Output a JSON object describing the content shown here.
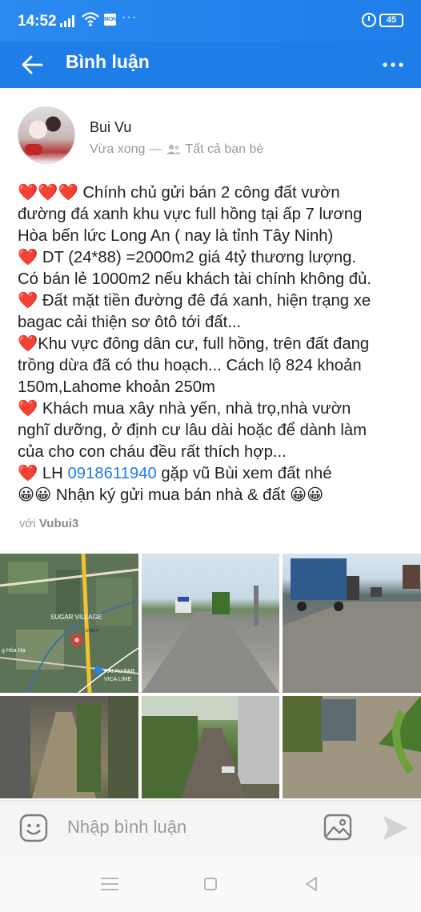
{
  "status_bar": {
    "time": "14:52",
    "battery": "45",
    "app_badge": "MON",
    "more_dots": "···"
  },
  "app_bar": {
    "title": "Bình luận",
    "back_icon": "arrow-left-icon",
    "more_icon": "more-horizontal-icon"
  },
  "post": {
    "author": "Bui Vu",
    "time": "Vừa xong",
    "separator": "—",
    "audience": "Tất cả bạn bè",
    "lines": [
      {
        "prefix": "❤️❤️❤️ ",
        "text": "Chính chủ gửi bán 2 công đất vườn\nđường đá xanh khu vực full hồng tại ấp 7 lương\nHòa bến lức Long An ( nay là tỉnh Tây Ninh)"
      },
      {
        "prefix": "❤️ ",
        "text": "DT (24*88) =2000m2 giá 4tỷ thương lượng.\nCó bán lẻ 1000m2 nếu khách tài chính không đủ."
      },
      {
        "prefix": "❤️ ",
        "text": "Đất mặt tiền đường đê đá xanh, hiện trạng xe\nbagac cải thiện sơ ôtô tới đất..."
      },
      {
        "prefix": "❤️",
        "text": "Khu vực đông dân cư, full hồng, trên đất đang\ntrồng dừa đã có thu hoạch... Cách lộ 824 khoản\n150m,Lahome khoản 250m"
      },
      {
        "prefix": "❤️ ",
        "text": "Khách mua xây nhà yến, nhà trọ,nhà vườn\nnghĩ dưỡng, ở định cư lâu dài hoặc để dành làm\ncủa cho con cháu đều rất thích hợp..."
      }
    ],
    "contact_prefix": "❤️ LH ",
    "phone": "0918611940",
    "contact_suffix": " gặp vũ Bùi xem đất nhé",
    "last_line": "😀😀 Nhận ký gửi mua bán nhà & đất 😀😀",
    "with_label": "với",
    "with_name": "Vubui3"
  },
  "photos": {
    "map_labels": [
      "SUGAR VILLAGE",
      "DT824",
      "HAI AU FAR",
      "VICA LIME",
      "g Hòa Ha"
    ]
  },
  "comment_bar": {
    "placeholder": "Nhập bình luận",
    "emoji_icon": "emoji-icon",
    "image_icon": "image-icon",
    "send_icon": "send-icon"
  },
  "colors": {
    "header": "#1f7de8",
    "link": "#1f7de8",
    "heart": "#e0282e"
  }
}
